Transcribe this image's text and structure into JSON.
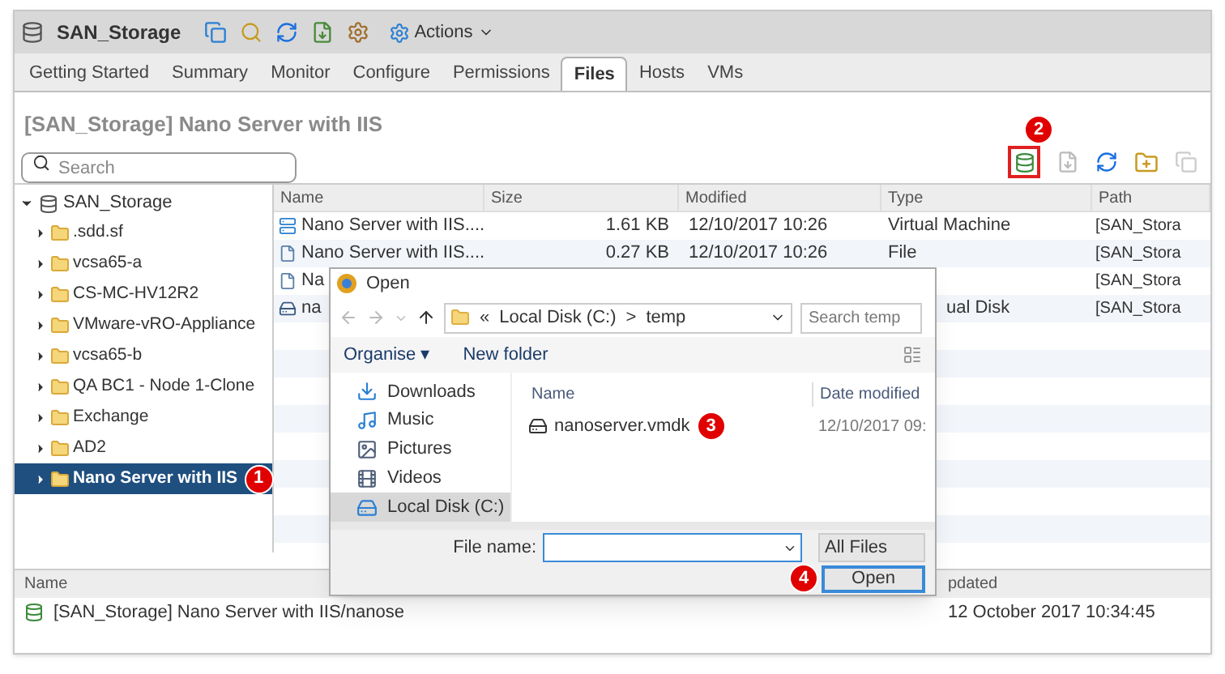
{
  "object_bar": {
    "title": "SAN_Storage",
    "actions": "Actions"
  },
  "tabs": [
    {
      "label": "Getting Started",
      "selected": false
    },
    {
      "label": "Summary",
      "selected": false
    },
    {
      "label": "Monitor",
      "selected": false
    },
    {
      "label": "Configure",
      "selected": false
    },
    {
      "label": "Permissions",
      "selected": false
    },
    {
      "label": "Files",
      "selected": true
    },
    {
      "label": "Hosts",
      "selected": false
    },
    {
      "label": "VMs",
      "selected": false
    }
  ],
  "heading": "[SAN_Storage] Nano Server with IIS",
  "search": {
    "placeholder": "Search"
  },
  "toolbar_badge": "2",
  "tree": {
    "label": "SAN_Storage",
    "expanded": true,
    "children": [
      {
        "label": ".sdd.sf",
        "selected": false
      },
      {
        "label": "vcsa65-a",
        "selected": false
      },
      {
        "label": "CS-MC-HV12R2",
        "selected": false
      },
      {
        "label": "VMware-vRO-Appliance",
        "selected": false
      },
      {
        "label": "vcsa65-b",
        "selected": false
      },
      {
        "label": "QA BC1 - Node 1-Clone",
        "selected": false
      },
      {
        "label": "Exchange",
        "selected": false
      },
      {
        "label": "AD2",
        "selected": false
      },
      {
        "label": "Nano Server with IIS",
        "selected": true,
        "badge": "1"
      }
    ]
  },
  "table": {
    "columns": [
      "Name",
      "Size",
      "Modified",
      "Type",
      "Path"
    ],
    "rows": [
      {
        "kind": "vm",
        "name": "Nano Server with IIS....",
        "size": "1.61 KB",
        "modified": "12/10/2017 10:26",
        "type": "Virtual Machine",
        "path": "[SAN_Stora"
      },
      {
        "kind": "file",
        "name": "Nano Server with IIS....",
        "size": "0.27 KB",
        "modified": "12/10/2017 10:26",
        "type": "File",
        "path": "[SAN_Stora"
      },
      {
        "kind": "file",
        "name": "Na",
        "path": "[SAN_Stora"
      },
      {
        "kind": "disk",
        "name": "na",
        "type": "ual Disk",
        "path": "[SAN_Stora"
      }
    ]
  },
  "tasks": {
    "columns": [
      "Name",
      "pdated"
    ],
    "rows": [
      {
        "name": "[SAN_Storage] Nano Server with IIS/nanose",
        "updated": "12 October 2017 10:34:45"
      }
    ]
  },
  "dialog": {
    "title": "Open",
    "address": [
      "«",
      "Local Disk (C:)",
      ">",
      "temp"
    ],
    "search": {
      "placeholder": "Search temp"
    },
    "commands": [
      "Organise ▾",
      "New folder"
    ],
    "nav": [
      {
        "label": "Downloads",
        "kind": "downloads",
        "selected": false
      },
      {
        "label": "Music",
        "kind": "music",
        "selected": false
      },
      {
        "label": "Pictures",
        "kind": "pictures",
        "selected": false
      },
      {
        "label": "Videos",
        "kind": "videos",
        "selected": false
      },
      {
        "label": "Local Disk (C:)",
        "kind": "disk",
        "selected": true
      }
    ],
    "columns": [
      "Name",
      "Date modified"
    ],
    "files": [
      {
        "name": "nanoserver.vmdk",
        "date": "12/10/2017 09:",
        "badge": "3"
      }
    ],
    "file_name_label": "File name:",
    "filter": "All Files",
    "open": {
      "label": "Open",
      "badge": "4"
    }
  }
}
